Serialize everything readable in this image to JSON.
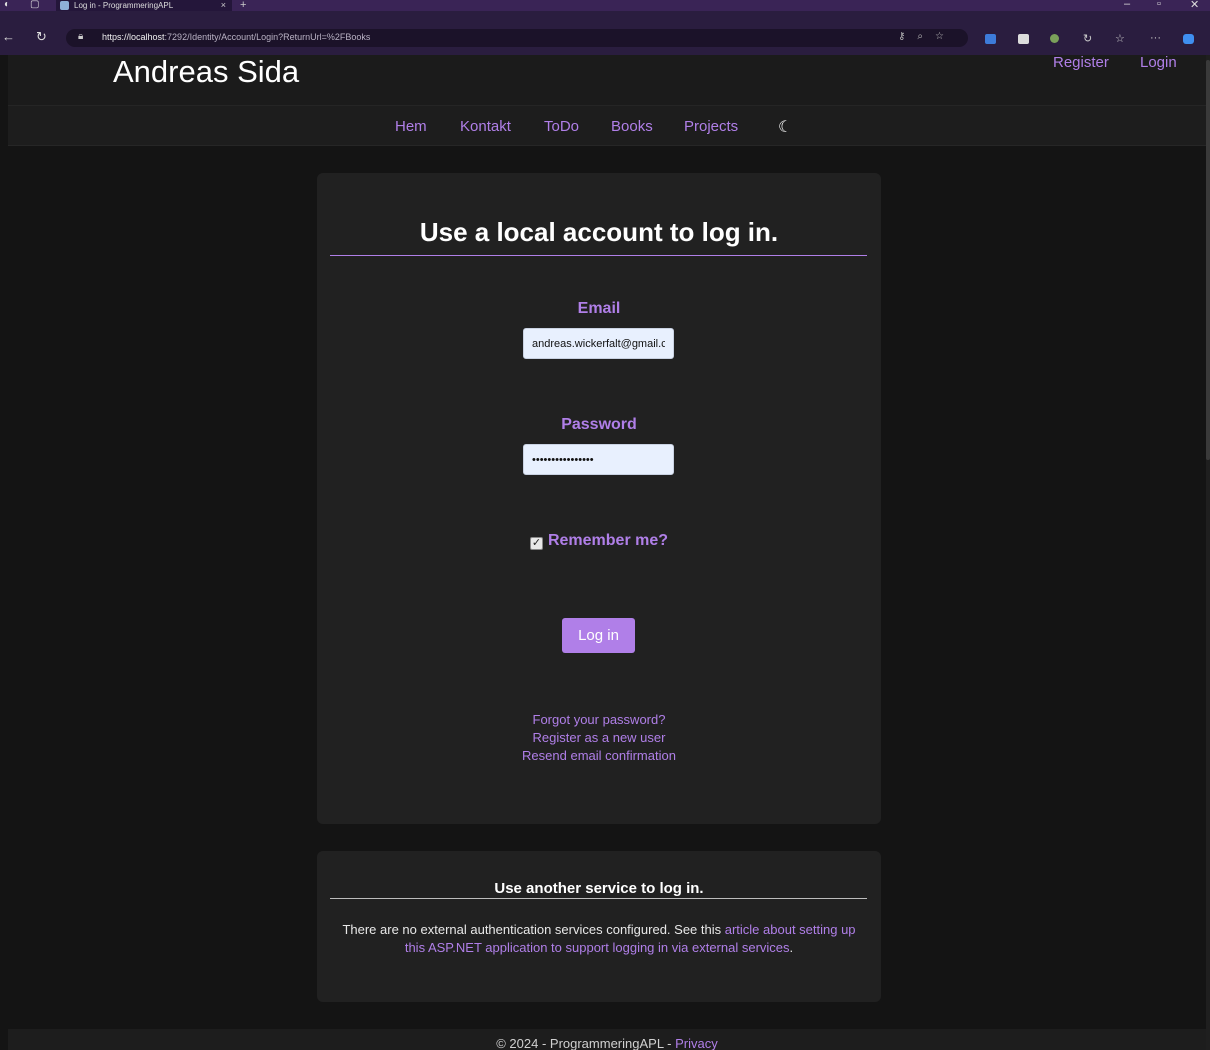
{
  "browser": {
    "tab_title": "Log in - ProgrammeringAPL",
    "tab_close": "×",
    "new_tab": "+",
    "url_host": "https://localhost",
    "url_rest": ":7292/Identity/Account/Login?ReturnUrl=%2FBooks"
  },
  "site": {
    "brand": "Andreas Sida",
    "register": "Register",
    "login": "Login",
    "nav": [
      "Hem",
      "Kontakt",
      "ToDo",
      "Books",
      "Projects"
    ]
  },
  "login_card": {
    "title": "Use a local account to log in.",
    "email_label": "Email",
    "email_value": "andreas.wickerfalt@gmail.com",
    "password_label": "Password",
    "password_value": "passwordpassword",
    "remember_label": "Remember me?",
    "remember_checked": true,
    "submit_label": "Log in",
    "links": {
      "forgot": "Forgot your password?",
      "register": "Register as a new user",
      "resend": "Resend email confirmation"
    }
  },
  "external_card": {
    "title": "Use another service to log in.",
    "text_before": "There are no external authentication services configured. See this ",
    "link_text": "article about setting up this ASP.NET application to support logging in via external services",
    "text_after": "."
  },
  "footer": {
    "copyright": "© 2024 - ProgrammeringAPL - ",
    "privacy": "Privacy"
  },
  "colors": {
    "accent": "#b07fe8",
    "background": "#141414",
    "card": "#212121"
  }
}
